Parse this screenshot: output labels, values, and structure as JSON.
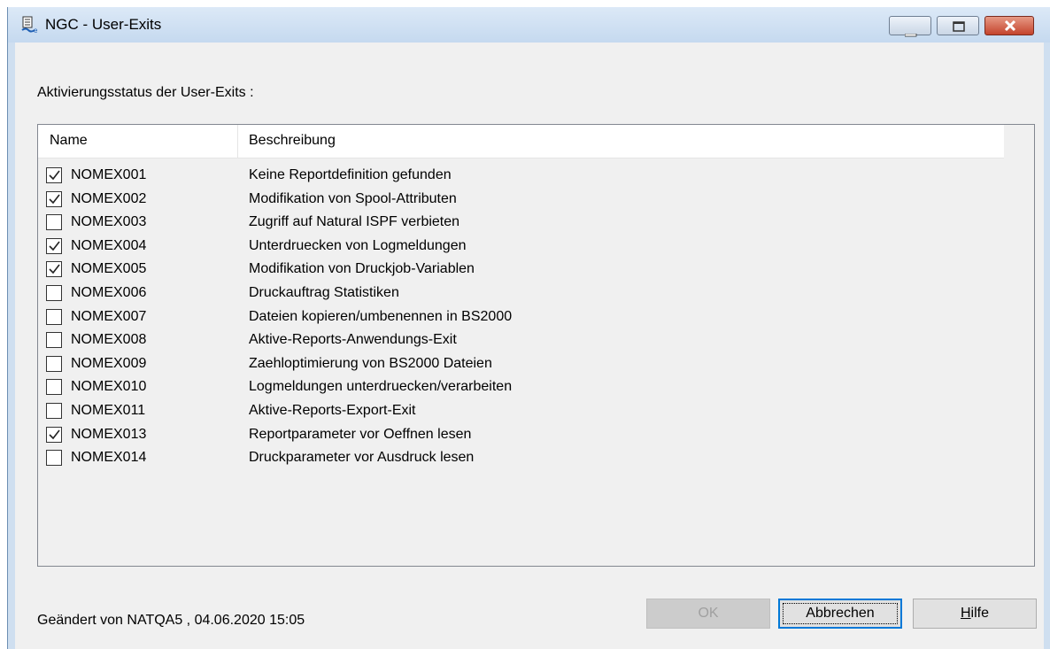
{
  "window": {
    "title": "NGC - User-Exits",
    "controls": [
      "minimize-icon",
      "maximize-icon",
      "close-icon"
    ]
  },
  "status_label": "Aktivierungsstatus der User-Exits :",
  "list": {
    "columns": [
      "Name",
      "Beschreibung"
    ],
    "rows": [
      {
        "name": "NOMEX001",
        "desc": "Keine Reportdefinition gefunden",
        "checked": true
      },
      {
        "name": "NOMEX002",
        "desc": "Modifikation von Spool-Attributen",
        "checked": true
      },
      {
        "name": "NOMEX003",
        "desc": "Zugriff auf Natural ISPF verbieten",
        "checked": false
      },
      {
        "name": "NOMEX004",
        "desc": "Unterdruecken von Logmeldungen",
        "checked": true
      },
      {
        "name": "NOMEX005",
        "desc": "Modifikation von Druckjob-Variablen",
        "checked": true
      },
      {
        "name": "NOMEX006",
        "desc": "Druckauftrag Statistiken",
        "checked": false
      },
      {
        "name": "NOMEX007",
        "desc": "Dateien kopieren/umbenennen in BS2000",
        "checked": false
      },
      {
        "name": "NOMEX008",
        "desc": "Aktive-Reports-Anwendungs-Exit",
        "checked": false
      },
      {
        "name": "NOMEX009",
        "desc": "Zaehloptimierung von BS2000 Dateien",
        "checked": false
      },
      {
        "name": "NOMEX010",
        "desc": "Logmeldungen unterdruecken/verarbeiten",
        "checked": false
      },
      {
        "name": "NOMEX011",
        "desc": "Aktive-Reports-Export-Exit",
        "checked": false
      },
      {
        "name": "NOMEX013",
        "desc": "Reportparameter vor Oeffnen lesen",
        "checked": true
      },
      {
        "name": "NOMEX014",
        "desc": "Druckparameter vor Ausdruck lesen",
        "checked": false
      }
    ]
  },
  "footer": {
    "changed_text": "Geändert von NATQA5 , 04.06.2020 15:05",
    "ok_label": "OK",
    "ok_enabled": false,
    "cancel_label": "Abbrechen",
    "help_mnemonic": "H",
    "help_rest": "ilfe"
  }
}
